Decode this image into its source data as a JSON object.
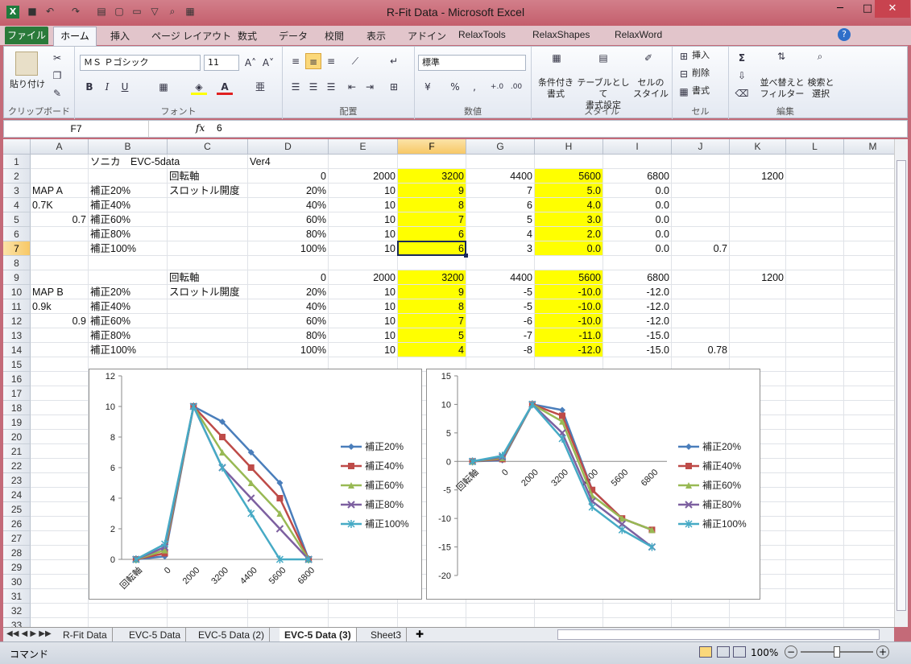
{
  "app": {
    "title": "R-Fit Data - Microsoft Excel",
    "excel_icon": "X"
  },
  "ribbon_tabs": {
    "file": "ファイル",
    "home": "ホーム",
    "items": [
      "挿入",
      "ページ レイアウト",
      "数式",
      "データ",
      "校閲",
      "表示",
      "アドイン",
      "RelaxTools",
      "RelaxShapes",
      "RelaxWord"
    ]
  },
  "clipboard": {
    "paste": "貼り付け",
    "label": "クリップボード"
  },
  "font": {
    "name": "ＭＳ Ｐゴシック",
    "size": "11",
    "label": "フォント",
    "bold": "B",
    "italic": "I",
    "underline": "U",
    "color_a": "A"
  },
  "align": {
    "label": "配置"
  },
  "number": {
    "format": "標準",
    "label": "数値",
    "percent": "%",
    "comma": ",",
    "inc": "+.0",
    "dec": ".00"
  },
  "style": {
    "cond": "条件付き\n書式",
    "table": "テーブルとして\n書式設定",
    "cell": "セルの\nスタイル",
    "label": "スタイル"
  },
  "cells": {
    "insert": "挿入",
    "delete": "削除",
    "format": "書式",
    "label": "セル"
  },
  "edit": {
    "sort": "並べ替えと\nフィルター",
    "find": "検索と\n選択",
    "label": "編集",
    "sigma": "Σ"
  },
  "formula": {
    "namebox": "F7",
    "fx": "fx",
    "value": "6"
  },
  "columns": [
    "A",
    "B",
    "C",
    "D",
    "E",
    "F",
    "G",
    "H",
    "I",
    "J",
    "K",
    "L",
    "M"
  ],
  "rows": [
    "1",
    "2",
    "3",
    "4",
    "5",
    "6",
    "7",
    "8",
    "9",
    "10",
    "11",
    "12",
    "13",
    "14",
    "15",
    "16",
    "17",
    "18",
    "19",
    "20",
    "21",
    "22",
    "23",
    "24",
    "25",
    "26",
    "27",
    "28",
    "29",
    "30",
    "31",
    "32",
    "33"
  ],
  "cells_data": {
    "B1": "ソニカ　EVC-5data",
    "D1": "Ver4",
    "C2": "回転軸",
    "D2": "0",
    "E2": "2000",
    "F2": "3200",
    "G2": "4400",
    "H2": "5600",
    "I2": "6800",
    "K2": "1200",
    "A3": "MAP A",
    "B3": "補正20%",
    "C3": "スロットル開度",
    "D3": "20%",
    "E3": "10",
    "F3": "9",
    "G3": "7",
    "H3": "5.0",
    "I3": "0.0",
    "A4": "0.7K",
    "B4": "補正40%",
    "D4": "40%",
    "E4": "10",
    "F4": "8",
    "G4": "6",
    "H4": "4.0",
    "I4": "0.0",
    "A5": "0.7",
    "B5": "補正60%",
    "D5": "60%",
    "E5": "10",
    "F5": "7",
    "G5": "5",
    "H5": "3.0",
    "I5": "0.0",
    "B6": "補正80%",
    "D6": "80%",
    "E6": "10",
    "F6": "6",
    "G6": "4",
    "H6": "2.0",
    "I6": "0.0",
    "B7": "補正100%",
    "D7": "100%",
    "E7": "10",
    "F7": "6",
    "G7": "3",
    "H7": "0.0",
    "I7": "0.0",
    "J7": "0.7",
    "C9": "回転軸",
    "D9": "0",
    "E9": "2000",
    "F9": "3200",
    "G9": "4400",
    "H9": "5600",
    "I9": "6800",
    "K9": "1200",
    "A10": "MAP B",
    "B10": "補正20%",
    "C10": "スロットル開度",
    "D10": "20%",
    "E10": "10",
    "F10": "9",
    "G10": "-5",
    "H10": "-10.0",
    "I10": "-12.0",
    "A11": "0.9k",
    "B11": "補正40%",
    "D11": "40%",
    "E11": "10",
    "F11": "8",
    "G11": "-5",
    "H11": "-10.0",
    "I11": "-12.0",
    "A12": "0.9",
    "B12": "補正60%",
    "D12": "60%",
    "E12": "10",
    "F12": "7",
    "G12": "-6",
    "H12": "-10.0",
    "I12": "-12.0",
    "B13": "補正80%",
    "D13": "80%",
    "E13": "10",
    "F13": "5",
    "G13": "-7",
    "H13": "-11.0",
    "I13": "-15.0",
    "B14": "補正100%",
    "D14": "100%",
    "E14": "10",
    "F14": "4",
    "G14": "-8",
    "H14": "-12.0",
    "I14": "-15.0",
    "J14": "0.78"
  },
  "sheet_tabs": [
    "R-Fit Data",
    "EVC-5 Data",
    "EVC-5 Data (2)",
    "EVC-5 Data (3)",
    "Sheet3"
  ],
  "active_sheet": "EVC-5 Data (3)",
  "status": {
    "mode": "コマンド",
    "zoom": "100%"
  },
  "colors": {
    "s1": "#4a7ebb",
    "s2": "#be4b48",
    "s3": "#98b954",
    "s4": "#7d60a0",
    "s5": "#46aac5",
    "highlight": "#ffff00"
  },
  "chart_data": [
    {
      "type": "line",
      "categories": [
        "回転軸",
        "0",
        "2000",
        "3200",
        "4400",
        "5600",
        "6800"
      ],
      "ylim": [
        0,
        12
      ],
      "yticks": [
        0,
        2,
        4,
        6,
        8,
        10,
        12
      ],
      "series": [
        {
          "name": "補正20%",
          "values": [
            0,
            0.2,
            10,
            9,
            7,
            5,
            0
          ]
        },
        {
          "name": "補正40%",
          "values": [
            0,
            0.4,
            10,
            8,
            6,
            4,
            0
          ]
        },
        {
          "name": "補正60%",
          "values": [
            0,
            0.6,
            10,
            7,
            5,
            3,
            0
          ]
        },
        {
          "name": "補正80%",
          "values": [
            0,
            0.8,
            10,
            6,
            4,
            2,
            0
          ]
        },
        {
          "name": "補正100%",
          "values": [
            0,
            1,
            10,
            6,
            3,
            0,
            0
          ]
        }
      ],
      "legend": "right"
    },
    {
      "type": "line",
      "categories": [
        "回転軸",
        "0",
        "2000",
        "3200",
        "4400",
        "5600",
        "6800"
      ],
      "ylim": [
        -20,
        15
      ],
      "yticks": [
        -20,
        -15,
        -10,
        -5,
        0,
        5,
        10,
        15
      ],
      "series": [
        {
          "name": "補正20%",
          "values": [
            0,
            0.2,
            10,
            9,
            -5,
            -10,
            -12
          ]
        },
        {
          "name": "補正40%",
          "values": [
            0,
            0.4,
            10,
            8,
            -5,
            -10,
            -12
          ]
        },
        {
          "name": "補正60%",
          "values": [
            0,
            0.6,
            10,
            7,
            -6,
            -10,
            -12
          ]
        },
        {
          "name": "補正80%",
          "values": [
            0,
            0.8,
            10,
            5,
            -7,
            -11,
            -15
          ]
        },
        {
          "name": "補正100%",
          "values": [
            0,
            1,
            10,
            4,
            -8,
            -12,
            -15
          ]
        }
      ],
      "legend": "right"
    }
  ]
}
